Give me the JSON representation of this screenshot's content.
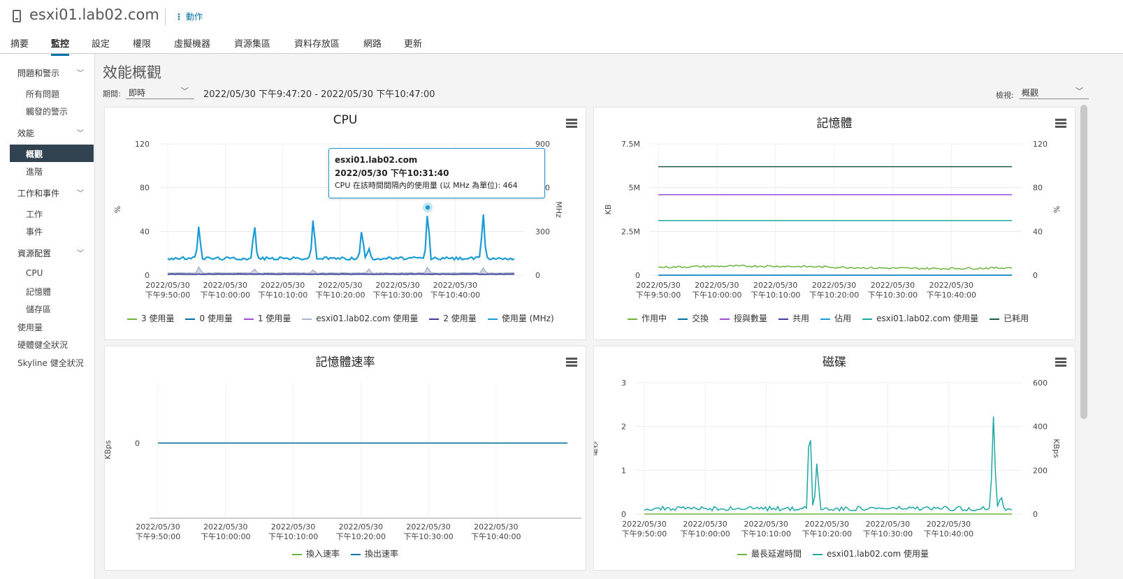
{
  "header": {
    "host": "esxi01.lab02.com",
    "actions_label": "動作"
  },
  "tabs": [
    "摘要",
    "監控",
    "設定",
    "權限",
    "虛擬機器",
    "資源集區",
    "資料存放區",
    "網路",
    "更新"
  ],
  "active_tab": "監控",
  "sidebar": {
    "groups": [
      {
        "label": "問題和警示",
        "items": [
          "所有問題",
          "觸發的警示"
        ]
      },
      {
        "label": "效能",
        "items": [
          "概觀",
          "進階"
        ]
      },
      {
        "label": "工作和事件",
        "items": [
          "工作",
          "事件"
        ]
      },
      {
        "label": "資源配置",
        "items": [
          "CPU",
          "記憶體",
          "儲存區"
        ]
      }
    ],
    "top_items": [
      "使用量",
      "硬體健全狀況",
      "Skyline 健全狀況"
    ],
    "active_item": "概觀"
  },
  "main": {
    "title": "效能概觀",
    "period_label": "期間:",
    "period_value": "即時",
    "time_range": "2022/05/30 下午9:47:20 - 2022/05/30 下午10:47:00",
    "view_label": "檢視:",
    "view_value": "概觀"
  },
  "tooltip": {
    "host": "esxi01.lab02.com",
    "time": "2022/05/30 下午10:31:40",
    "detail": "CPU 在該時間間隔內的使用量 (以 MHz 為單位): 464"
  },
  "x_ticks": [
    {
      "date": "2022/05/30",
      "time": "下午9:50:00"
    },
    {
      "date": "2022/05/30",
      "time": "下午10:00:00"
    },
    {
      "date": "2022/05/30",
      "time": "下午10:10:00"
    },
    {
      "date": "2022/05/30",
      "time": "下午10:20:00"
    },
    {
      "date": "2022/05/30",
      "time": "下午10:30:00"
    },
    {
      "date": "2022/05/30",
      "time": "下午10:40:00"
    }
  ],
  "colors": {
    "green": "#6db33f",
    "blue": "#0072a3",
    "purple": "#9e4cd3",
    "teal": "#1ea7a3",
    "navy": "#3d3d9e",
    "lightblue": "#1a9bd4",
    "darkgreen": "#1e5a46",
    "gray": "#a8b4c8"
  },
  "chart_data": [
    {
      "type": "line",
      "title": "CPU",
      "ylabel": "%",
      "y2label": "MHz",
      "ylim": [
        0,
        120
      ],
      "y2lim": [
        0,
        900
      ],
      "yticks": [
        0,
        40,
        80,
        120
      ],
      "y2ticks": [
        0,
        300,
        600,
        900
      ],
      "grid": true,
      "legend_position": "bottom",
      "series": [
        {
          "name": "3 使用量",
          "color": "#6db33f",
          "axis": "left",
          "baseline": 1,
          "spikes": []
        },
        {
          "name": "0 使用量",
          "color": "#0072a3",
          "axis": "left",
          "baseline": 1,
          "spikes": []
        },
        {
          "name": "1 使用量",
          "color": "#9e4cd3",
          "axis": "left",
          "baseline": 1,
          "spikes": []
        },
        {
          "name": "esxi01.lab02.com 使用量",
          "color": "#a8b4c8",
          "axis": "left",
          "baseline": 2,
          "spikes": [
            [
              0.09,
              8
            ],
            [
              0.25,
              6
            ],
            [
              0.42,
              5
            ],
            [
              0.58,
              6
            ],
            [
              0.75,
              8
            ],
            [
              0.91,
              7
            ]
          ]
        },
        {
          "name": "2 使用量",
          "color": "#3d3d9e",
          "axis": "left",
          "baseline": 1,
          "spikes": []
        },
        {
          "name": "使用量 (MHz)",
          "color": "#1a9bd4",
          "axis": "right",
          "baseline": 115,
          "spikes": [
            [
              0.09,
              350
            ],
            [
              0.25,
              370
            ],
            [
              0.42,
              410
            ],
            [
              0.56,
              330
            ],
            [
              0.58,
              190
            ],
            [
              0.75,
              464
            ],
            [
              0.91,
              440
            ]
          ]
        }
      ]
    },
    {
      "type": "line",
      "title": "記憶體",
      "ylabel": "KB",
      "y2label": "%",
      "ylim": [
        0,
        7500000
      ],
      "y2lim": [
        0,
        120
      ],
      "yticks": [
        "0",
        "2.5M",
        "5M",
        "7.5M"
      ],
      "y2ticks": [
        0,
        40,
        80,
        120
      ],
      "grid": true,
      "legend_position": "bottom",
      "series": [
        {
          "name": "作用中",
          "color": "#6db33f",
          "axis": "left",
          "baseline": 450000
        },
        {
          "name": "交換",
          "color": "#0072a3",
          "axis": "left",
          "baseline": 0
        },
        {
          "name": "授與數量",
          "color": "#9e4cd3",
          "axis": "left",
          "baseline": 4600000
        },
        {
          "name": "共用",
          "color": "#3d3d9e",
          "axis": "left",
          "baseline": 0
        },
        {
          "name": "佔用",
          "color": "#1a9bd4",
          "axis": "left",
          "baseline": 0
        },
        {
          "name": "esxi01.lab02.com 使用量",
          "color": "#1ea7a3",
          "axis": "right",
          "baseline": 50
        },
        {
          "name": "已耗用",
          "color": "#1e5a46",
          "axis": "left",
          "baseline": 6200000
        }
      ]
    },
    {
      "type": "line",
      "title": "記憶體速率",
      "ylabel": "KBps",
      "ylim": [
        0,
        0
      ],
      "yticks": [
        0
      ],
      "grid": true,
      "legend_position": "bottom",
      "series": [
        {
          "name": "換入速率",
          "color": "#6db33f",
          "baseline": 0
        },
        {
          "name": "換出速率",
          "color": "#0072a3",
          "baseline": 0
        }
      ]
    },
    {
      "type": "line",
      "title": "磁碟",
      "ylabel": "毫秒",
      "y2label": "KBps",
      "ylim": [
        0,
        3
      ],
      "y2lim": [
        0,
        600
      ],
      "yticks": [
        0,
        1,
        2,
        3
      ],
      "y2ticks": [
        0,
        200,
        400,
        600
      ],
      "grid": true,
      "legend_position": "bottom",
      "series": [
        {
          "name": "最長延遲時間",
          "color": "#6db33f",
          "axis": "left",
          "baseline": 0
        },
        {
          "name": "esxi01.lab02.com 使用量",
          "color": "#1ea7a3",
          "axis": "right",
          "baseline": 25,
          "spikes": [
            [
              0.45,
              470
            ],
            [
              0.47,
              250
            ],
            [
              0.95,
              460
            ],
            [
              0.97,
              90
            ]
          ]
        }
      ]
    }
  ]
}
